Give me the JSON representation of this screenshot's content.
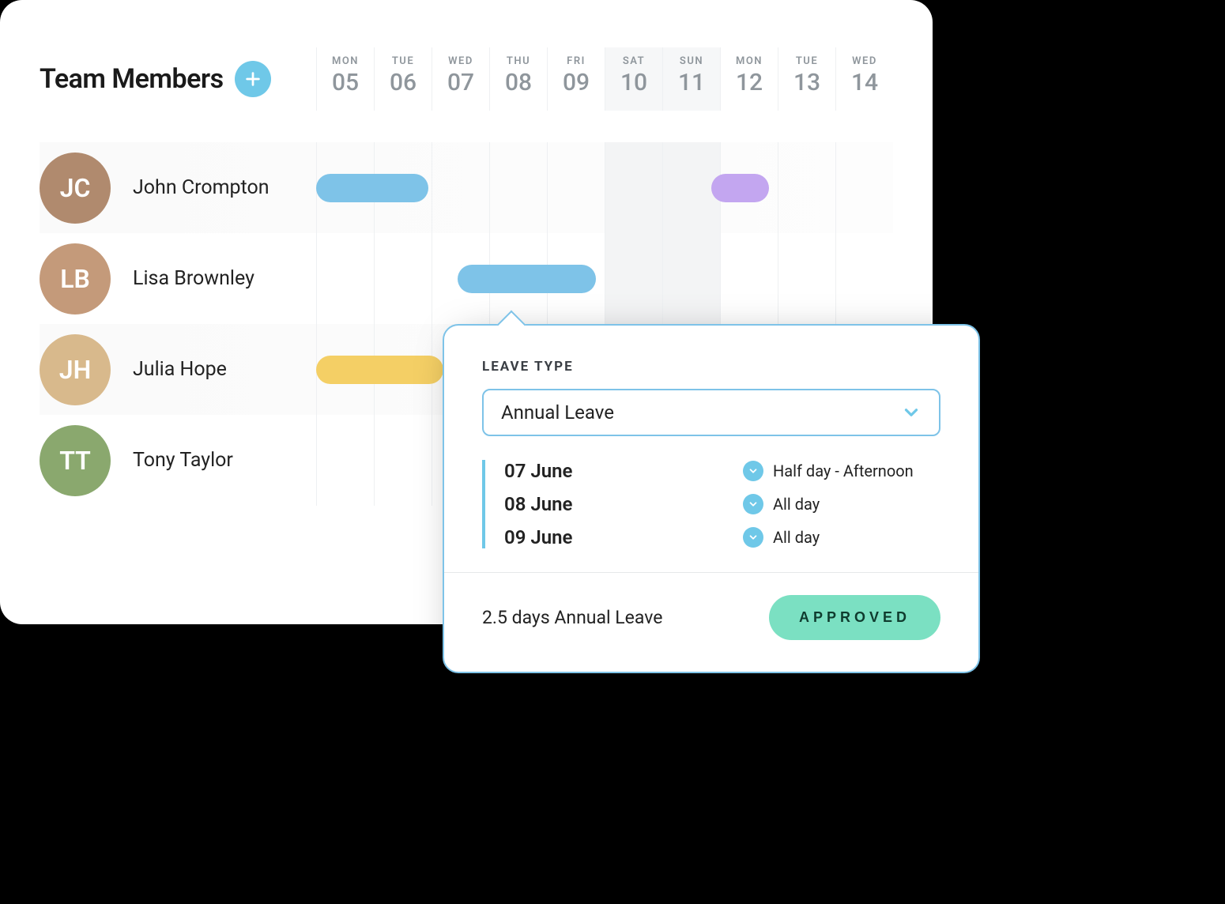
{
  "header": {
    "title": "Team Members",
    "addIcon": "plus-icon"
  },
  "days": [
    {
      "dow": "MON",
      "num": "05",
      "weekend": false
    },
    {
      "dow": "TUE",
      "num": "06",
      "weekend": false
    },
    {
      "dow": "WED",
      "num": "07",
      "weekend": false
    },
    {
      "dow": "THU",
      "num": "08",
      "weekend": false
    },
    {
      "dow": "FRI",
      "num": "09",
      "weekend": false
    },
    {
      "dow": "SAT",
      "num": "10",
      "weekend": true
    },
    {
      "dow": "SUN",
      "num": "11",
      "weekend": true
    },
    {
      "dow": "MON",
      "num": "12",
      "weekend": false
    },
    {
      "dow": "TUE",
      "num": "13",
      "weekend": false
    },
    {
      "dow": "WED",
      "num": "14",
      "weekend": false
    }
  ],
  "members": [
    {
      "name": "John Crompton",
      "avatarColor": "#b08a6e",
      "initials": "JC",
      "shaded": true,
      "bars": [
        {
          "color": "blue",
          "startPct": 0,
          "widthPct": 19.5
        },
        {
          "color": "purple",
          "startPct": 68.5,
          "widthPct": 10
        }
      ]
    },
    {
      "name": "Lisa Brownley",
      "avatarColor": "#c49a7a",
      "initials": "LB",
      "shaded": false,
      "bars": [
        {
          "color": "blue",
          "startPct": 24.5,
          "widthPct": 24
        }
      ]
    },
    {
      "name": "Julia Hope",
      "avatarColor": "#d8b98c",
      "initials": "JH",
      "shaded": true,
      "bars": [
        {
          "color": "yellow",
          "startPct": 0,
          "widthPct": 22
        }
      ]
    },
    {
      "name": "Tony Taylor",
      "avatarColor": "#8aa86e",
      "initials": "TT",
      "shaded": false,
      "bars": []
    }
  ],
  "popover": {
    "label": "LEAVE TYPE",
    "selected": "Annual Leave",
    "dates": [
      {
        "date": "07 June",
        "duration": "Half day - Afternoon"
      },
      {
        "date": "08 June",
        "duration": "All day"
      },
      {
        "date": "09 June",
        "duration": "All day"
      }
    ],
    "summary": "2.5 days Annual Leave",
    "status": "APPROVED"
  },
  "colors": {
    "accent": "#6fc8e8",
    "blue": "#7ec3e8",
    "purple": "#c3a6f0",
    "yellow": "#f4cf65",
    "approved": "#7be0c2"
  }
}
